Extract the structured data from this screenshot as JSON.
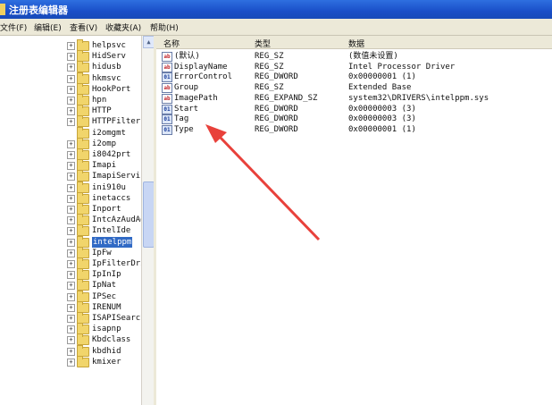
{
  "window": {
    "title": "注册表编辑器"
  },
  "menu": [
    "文件(F)",
    "编辑(E)",
    "查看(V)",
    "收藏夹(A)",
    "帮助(H)"
  ],
  "tree": {
    "items": [
      {
        "label": "helpsvc",
        "expander": "+"
      },
      {
        "label": "HidServ",
        "expander": "+"
      },
      {
        "label": "hidusb",
        "expander": "+"
      },
      {
        "label": "hkmsvc",
        "expander": "+"
      },
      {
        "label": "HookPort",
        "expander": "+"
      },
      {
        "label": "hpn",
        "expander": "+"
      },
      {
        "label": "HTTP",
        "expander": "+"
      },
      {
        "label": "HTTPFilter",
        "expander": "+"
      },
      {
        "label": "i2omgmt",
        "expander": ""
      },
      {
        "label": "i2omp",
        "expander": "+"
      },
      {
        "label": "i8042prt",
        "expander": "+"
      },
      {
        "label": "Imapi",
        "expander": "+"
      },
      {
        "label": "ImapiService",
        "expander": "+"
      },
      {
        "label": "ini910u",
        "expander": "+"
      },
      {
        "label": "inetaccs",
        "expander": "+"
      },
      {
        "label": "Inport",
        "expander": "+"
      },
      {
        "label": "IntcAzAudAdd",
        "expander": "+"
      },
      {
        "label": "IntelIde",
        "expander": "+"
      },
      {
        "label": "intelppm",
        "expander": "+",
        "selected": true
      },
      {
        "label": "IpFw",
        "expander": "+"
      },
      {
        "label": "IpFilterDriver",
        "expander": "+"
      },
      {
        "label": "IpInIp",
        "expander": "+"
      },
      {
        "label": "IpNat",
        "expander": "+"
      },
      {
        "label": "IPSec",
        "expander": "+"
      },
      {
        "label": "IRENUM",
        "expander": "+"
      },
      {
        "label": "ISAPISearch",
        "expander": "+"
      },
      {
        "label": "isapnp",
        "expander": "+"
      },
      {
        "label": "Kbdclass",
        "expander": "+"
      },
      {
        "label": "kbdhid",
        "expander": "+"
      },
      {
        "label": "kmixer",
        "expander": "+"
      }
    ]
  },
  "list": {
    "columns": {
      "name": "名称",
      "type": "类型",
      "data": "数据"
    },
    "rows": [
      {
        "icon": "string-value-icon",
        "icon_text": "ab",
        "name": "(默认)",
        "type": "REG_SZ",
        "data": "(数值未设置)"
      },
      {
        "icon": "string-value-icon",
        "icon_text": "ab",
        "name": "DisplayName",
        "type": "REG_SZ",
        "data": "Intel Processor Driver"
      },
      {
        "icon": "binary-value-icon",
        "icon_text": "01",
        "name": "ErrorControl",
        "type": "REG_DWORD",
        "data": "0x00000001 (1)"
      },
      {
        "icon": "string-value-icon",
        "icon_text": "ab",
        "name": "Group",
        "type": "REG_SZ",
        "data": "Extended Base"
      },
      {
        "icon": "string-value-icon",
        "icon_text": "ab",
        "name": "ImagePath",
        "type": "REG_EXPAND_SZ",
        "data": "system32\\DRIVERS\\intelppm.sys"
      },
      {
        "icon": "binary-value-icon",
        "icon_text": "01",
        "name": "Start",
        "type": "REG_DWORD",
        "data": "0x00000003 (3)"
      },
      {
        "icon": "binary-value-icon",
        "icon_text": "01",
        "name": "Tag",
        "type": "REG_DWORD",
        "data": "0x00000003 (3)"
      },
      {
        "icon": "binary-value-icon",
        "icon_text": "01",
        "name": "Type",
        "type": "REG_DWORD",
        "data": "0x00000001 (1)"
      }
    ]
  },
  "annotation": {
    "color": "#e8413b",
    "points_to": "Start"
  }
}
